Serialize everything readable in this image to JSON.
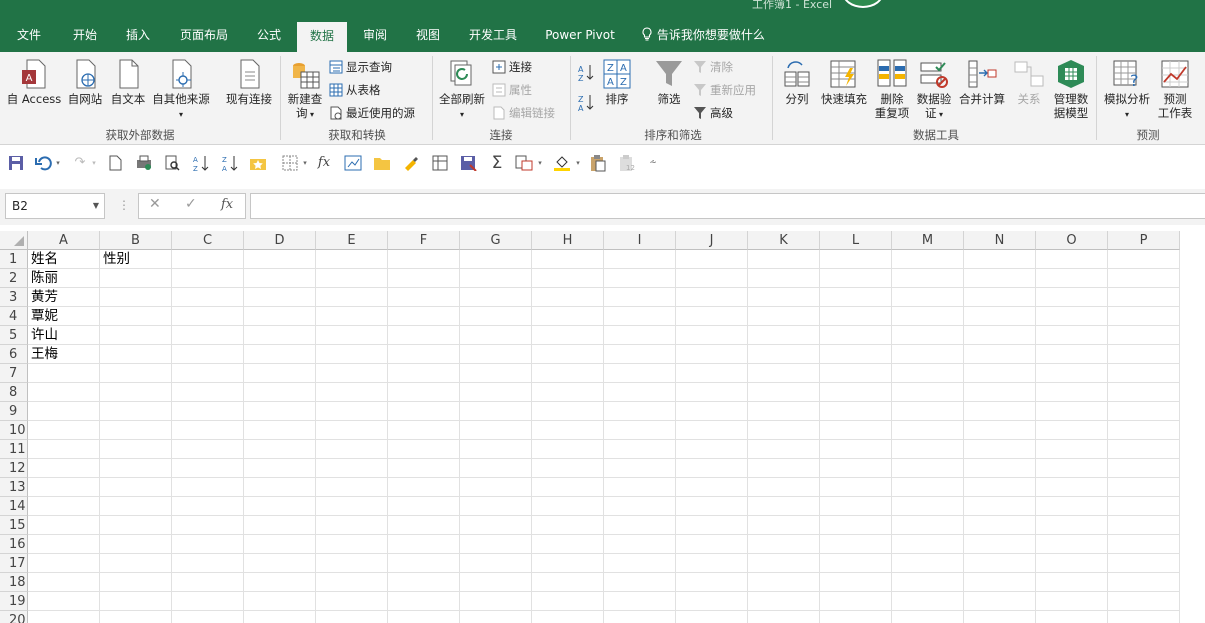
{
  "title_bar": {
    "text": "工作簿1  -  Excel"
  },
  "tabs": [
    {
      "label": "文件"
    },
    {
      "label": "开始"
    },
    {
      "label": "插入"
    },
    {
      "label": "页面布局"
    },
    {
      "label": "公式"
    },
    {
      "label": "数据",
      "active": true
    },
    {
      "label": "审阅"
    },
    {
      "label": "视图"
    },
    {
      "label": "开发工具"
    },
    {
      "label": "Power Pivot"
    }
  ],
  "tell_me": "告诉我你想要做什么",
  "ribbon": {
    "get_external": {
      "from_access": "自 Access",
      "from_web": "自网站",
      "from_text": "自文本",
      "from_other": "自其他来源",
      "existing": "现有连接",
      "group_label": "获取外部数据"
    },
    "get_transform": {
      "new_query_1": "新建查",
      "new_query_2": "询",
      "show_queries": "显示查询",
      "from_table": "从表格",
      "recent_sources": "最近使用的源",
      "group_label": "获取和转换"
    },
    "connections": {
      "refresh_all": "全部刷新",
      "connections": "连接",
      "properties": "属性",
      "edit_links": "编辑链接",
      "group_label": "连接"
    },
    "sort_filter": {
      "sort": "排序",
      "filter": "筛选",
      "clear": "清除",
      "reapply": "重新应用",
      "advanced": "高级",
      "group_label": "排序和筛选"
    },
    "data_tools": {
      "text_to_columns": "分列",
      "flash_fill": "快速填充",
      "remove_dup_1": "删除",
      "remove_dup_2": "重复项",
      "validation_1": "数据验",
      "validation_2": "证",
      "consolidate": "合并计算",
      "relationships": "关系",
      "manage_model_1": "管理数",
      "manage_model_2": "据模型",
      "group_label": "数据工具"
    },
    "forecast": {
      "what_if": "模拟分析",
      "forecast_sheet_1": "预测",
      "forecast_sheet_2": "工作表",
      "group_label": "预测"
    }
  },
  "formula_bar": {
    "name_box": "B2",
    "fx": "fx",
    "formula": ""
  },
  "colors": {
    "accent": "#217346",
    "ribbon_bg": "#f3f3f3",
    "grid_line": "#e1e1e1"
  },
  "columns": [
    "A",
    "B",
    "C",
    "D",
    "E",
    "F",
    "G",
    "H",
    "I",
    "J",
    "K",
    "L",
    "M",
    "N",
    "O",
    "P"
  ],
  "rows": [
    "1",
    "2",
    "3",
    "4",
    "5",
    "6",
    "7",
    "8",
    "9",
    "10",
    "11",
    "12",
    "13",
    "14",
    "15",
    "16",
    "17",
    "18",
    "19",
    "20"
  ],
  "cells": {
    "A1": "姓名",
    "B1": "性别",
    "A2": "陈丽",
    "A3": "黄芳",
    "A4": "覃妮",
    "A5": "许山",
    "A6": "王梅"
  }
}
